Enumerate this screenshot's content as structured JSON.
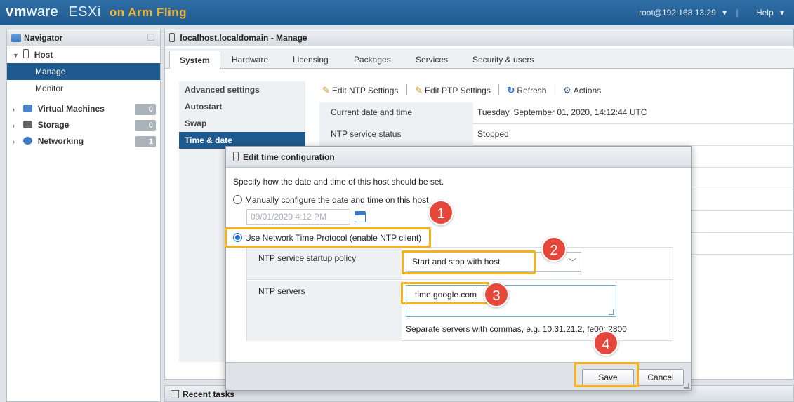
{
  "topbar": {
    "brand_vm": "vm",
    "brand_ware": "ware",
    "product": "ESXi",
    "edition": "on Arm Fling",
    "user": "root@192.168.13.29",
    "help": "Help"
  },
  "navigator": {
    "title": "Navigator",
    "host_label": "Host",
    "host_items": [
      "Manage",
      "Monitor"
    ],
    "groups": [
      {
        "label": "Virtual Machines",
        "count": "0",
        "icon": "vm-icon",
        "color": "#4a86c8"
      },
      {
        "label": "Storage",
        "count": "0",
        "icon": "storage-icon",
        "color": "#666666"
      },
      {
        "label": "Networking",
        "count": "1",
        "icon": "networking-icon",
        "color": "#3a78c2"
      }
    ]
  },
  "main": {
    "title": "localhost.localdomain - Manage",
    "tabs": [
      "System",
      "Hardware",
      "Licensing",
      "Packages",
      "Services",
      "Security & users"
    ],
    "subnav": [
      "Advanced settings",
      "Autostart",
      "Swap",
      "Time & date"
    ],
    "toolbar": {
      "edit_ntp": "Edit NTP Settings",
      "edit_ptp": "Edit PTP Settings",
      "refresh": "Refresh",
      "actions": "Actions"
    },
    "props": [
      {
        "key": "Current date and time",
        "value": "Tuesday, September 01, 2020, 14:12:44 UTC"
      },
      {
        "key": "NTP service status",
        "value": "Stopped"
      }
    ]
  },
  "recent": {
    "title": "Recent tasks"
  },
  "dialog": {
    "title": "Edit time configuration",
    "intro": "Specify how the date and time of this host should be set.",
    "manual_label": "Manually configure the date and time on this host",
    "manual_value": "09/01/2020 4:12 PM",
    "ntp_label": "Use Network Time Protocol (enable NTP client)",
    "policy_label": "NTP service startup policy",
    "policy_value": "Start and stop with host",
    "servers_label": "NTP servers",
    "servers_value": "time.google.com",
    "servers_hint": "Separate servers with commas, e.g. 10.31.21.2, fe00::2800",
    "save": "Save",
    "cancel": "Cancel"
  },
  "callouts": [
    "1",
    "2",
    "3",
    "4"
  ],
  "colors": {
    "accent": "#1f5a8e",
    "highlight": "#f5b21a",
    "callout": "#e5483a",
    "brand_fling": "#f5b731"
  }
}
